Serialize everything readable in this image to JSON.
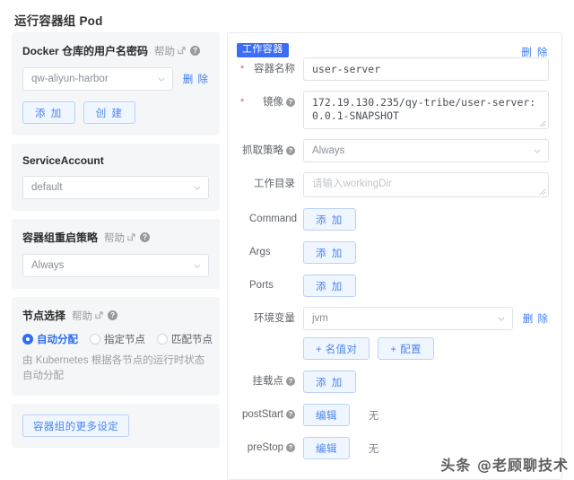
{
  "page": {
    "title": "运行容器组 Pod"
  },
  "common": {
    "help_label": "帮助",
    "add_label": "添 加",
    "delete_label": "删 除",
    "edit_label": "编辑",
    "none_label": "无",
    "question_glyph": "?"
  },
  "left": {
    "cards": [
      {
        "title": "Docker 仓库的用户名密码",
        "has_help": true,
        "select_value": "qw-aliyun-harbor",
        "delete_label": "删 除",
        "buttons": [
          "添 加",
          "创 建"
        ]
      },
      {
        "title": "ServiceAccount",
        "has_help": false,
        "select_value": "default"
      },
      {
        "title": "容器组重启策略",
        "has_help": true,
        "select_value": "Always"
      },
      {
        "title": "节点选择",
        "has_help": true,
        "radios": [
          {
            "label": "自动分配",
            "selected": true
          },
          {
            "label": "指定节点",
            "selected": false
          },
          {
            "label": "匹配节点",
            "selected": false
          }
        ],
        "hint": "由 Kubernetes 根据各节点的运行时状态自动分配"
      },
      {
        "more_button": "容器组的更多设定"
      }
    ]
  },
  "right": {
    "tag": "工作容器",
    "delete_label": "删 除",
    "fields": {
      "container_name": {
        "label": "容器名称",
        "required": true,
        "value": "user-server"
      },
      "image": {
        "label": "镜像",
        "required": true,
        "has_help": true,
        "value": "172.19.130.235/qy-tribe/user-server:0.0.1-SNAPSHOT"
      },
      "pull_policy": {
        "label": "抓取策略",
        "has_help": true,
        "value": "Always"
      },
      "working_dir": {
        "label": "工作目录",
        "placeholder": "请输入workingDir"
      },
      "command": {
        "label": "Command",
        "button": "添 加"
      },
      "args": {
        "label": "Args",
        "button": "添 加"
      },
      "ports": {
        "label": "Ports",
        "button": "添 加"
      },
      "env": {
        "label": "环境变量",
        "value": "jvm",
        "delete_label": "删 除",
        "buttons": [
          "+ 名值对",
          "+ 配置"
        ]
      },
      "mounts": {
        "label": "挂载点",
        "has_help": true,
        "button": "添 加"
      },
      "post_start": {
        "label": "postStart",
        "has_help": true,
        "button": "编辑",
        "value": "无"
      },
      "pre_stop": {
        "label": "preStop",
        "has_help": true,
        "button": "编辑",
        "value": "无"
      }
    }
  },
  "watermark": {
    "text": "头条 @老顾聊技术"
  },
  "colors": {
    "accent": "#3b6ef5",
    "link": "#3b7cf5",
    "card_bg": "#f5f6f7",
    "border": "#e0e2e5",
    "required": "#e45b5b"
  }
}
